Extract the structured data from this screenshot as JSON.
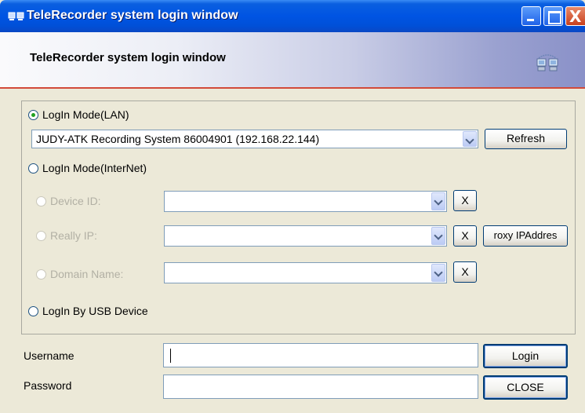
{
  "window": {
    "title": "TeleRecorder system login window",
    "close_glyph": "X"
  },
  "banner": {
    "title": "TeleRecorder system login window",
    "icon": "network-computers-icon"
  },
  "login_mode": {
    "lan": {
      "label": "LogIn Mode(LAN)",
      "selected": true,
      "device_value": "JUDY-ATK Recording System 86004901 (192.168.22.144)",
      "refresh_label": "Refresh"
    },
    "internet": {
      "label": "LogIn Mode(InterNet)",
      "selected": false,
      "device_id_label": "Device ID:",
      "device_id_value": "",
      "really_ip_label": "Really IP:",
      "really_ip_value": "",
      "domain_name_label": "Domain Name:",
      "domain_name_value": "",
      "clear_label": "X",
      "proxy_label": "roxy IPAddres"
    },
    "usb": {
      "label": "LogIn By USB Device",
      "selected": false
    }
  },
  "credentials": {
    "username_label": "Username",
    "username_value": "",
    "password_label": "Password",
    "password_value": "",
    "login_label": "Login",
    "close_label": "CLOSE"
  }
}
